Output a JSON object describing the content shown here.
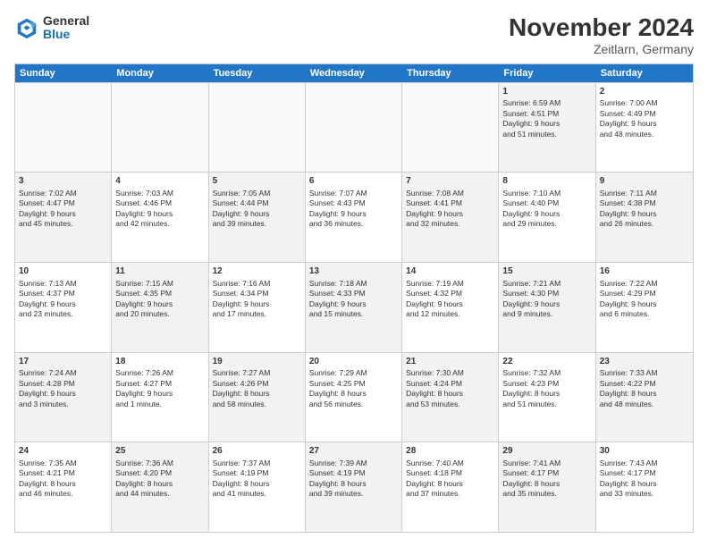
{
  "logo": {
    "general": "General",
    "blue": "Blue"
  },
  "title": "November 2024",
  "subtitle": "Zeitlarn, Germany",
  "header": {
    "days": [
      "Sunday",
      "Monday",
      "Tuesday",
      "Wednesday",
      "Thursday",
      "Friday",
      "Saturday"
    ]
  },
  "weeks": [
    {
      "cells": [
        {
          "day": "",
          "content": "",
          "empty": true
        },
        {
          "day": "",
          "content": "",
          "empty": true
        },
        {
          "day": "",
          "content": "",
          "empty": true
        },
        {
          "day": "",
          "content": "",
          "empty": true
        },
        {
          "day": "",
          "content": "",
          "empty": true
        },
        {
          "day": "1",
          "content": "Sunrise: 6:59 AM\nSunset: 4:51 PM\nDaylight: 9 hours\nand 51 minutes.",
          "shaded": true
        },
        {
          "day": "2",
          "content": "Sunrise: 7:00 AM\nSunset: 4:49 PM\nDaylight: 9 hours\nand 48 minutes.",
          "shaded": false
        }
      ]
    },
    {
      "cells": [
        {
          "day": "3",
          "content": "Sunrise: 7:02 AM\nSunset: 4:47 PM\nDaylight: 9 hours\nand 45 minutes.",
          "shaded": true
        },
        {
          "day": "4",
          "content": "Sunrise: 7:03 AM\nSunset: 4:46 PM\nDaylight: 9 hours\nand 42 minutes.",
          "shaded": false
        },
        {
          "day": "5",
          "content": "Sunrise: 7:05 AM\nSunset: 4:44 PM\nDaylight: 9 hours\nand 39 minutes.",
          "shaded": true
        },
        {
          "day": "6",
          "content": "Sunrise: 7:07 AM\nSunset: 4:43 PM\nDaylight: 9 hours\nand 36 minutes.",
          "shaded": false
        },
        {
          "day": "7",
          "content": "Sunrise: 7:08 AM\nSunset: 4:41 PM\nDaylight: 9 hours\nand 32 minutes.",
          "shaded": true
        },
        {
          "day": "8",
          "content": "Sunrise: 7:10 AM\nSunset: 4:40 PM\nDaylight: 9 hours\nand 29 minutes.",
          "shaded": false
        },
        {
          "day": "9",
          "content": "Sunrise: 7:11 AM\nSunset: 4:38 PM\nDaylight: 9 hours\nand 26 minutes.",
          "shaded": true
        }
      ]
    },
    {
      "cells": [
        {
          "day": "10",
          "content": "Sunrise: 7:13 AM\nSunset: 4:37 PM\nDaylight: 9 hours\nand 23 minutes.",
          "shaded": false
        },
        {
          "day": "11",
          "content": "Sunrise: 7:15 AM\nSunset: 4:35 PM\nDaylight: 9 hours\nand 20 minutes.",
          "shaded": true
        },
        {
          "day": "12",
          "content": "Sunrise: 7:16 AM\nSunset: 4:34 PM\nDaylight: 9 hours\nand 17 minutes.",
          "shaded": false
        },
        {
          "day": "13",
          "content": "Sunrise: 7:18 AM\nSunset: 4:33 PM\nDaylight: 9 hours\nand 15 minutes.",
          "shaded": true
        },
        {
          "day": "14",
          "content": "Sunrise: 7:19 AM\nSunset: 4:32 PM\nDaylight: 9 hours\nand 12 minutes.",
          "shaded": false
        },
        {
          "day": "15",
          "content": "Sunrise: 7:21 AM\nSunset: 4:30 PM\nDaylight: 9 hours\nand 9 minutes.",
          "shaded": true
        },
        {
          "day": "16",
          "content": "Sunrise: 7:22 AM\nSunset: 4:29 PM\nDaylight: 9 hours\nand 6 minutes.",
          "shaded": false
        }
      ]
    },
    {
      "cells": [
        {
          "day": "17",
          "content": "Sunrise: 7:24 AM\nSunset: 4:28 PM\nDaylight: 9 hours\nand 3 minutes.",
          "shaded": true
        },
        {
          "day": "18",
          "content": "Sunrise: 7:26 AM\nSunset: 4:27 PM\nDaylight: 9 hours\nand 1 minute.",
          "shaded": false
        },
        {
          "day": "19",
          "content": "Sunrise: 7:27 AM\nSunset: 4:26 PM\nDaylight: 8 hours\nand 58 minutes.",
          "shaded": true
        },
        {
          "day": "20",
          "content": "Sunrise: 7:29 AM\nSunset: 4:25 PM\nDaylight: 8 hours\nand 56 minutes.",
          "shaded": false
        },
        {
          "day": "21",
          "content": "Sunrise: 7:30 AM\nSunset: 4:24 PM\nDaylight: 8 hours\nand 53 minutes.",
          "shaded": true
        },
        {
          "day": "22",
          "content": "Sunrise: 7:32 AM\nSunset: 4:23 PM\nDaylight: 8 hours\nand 51 minutes.",
          "shaded": false
        },
        {
          "day": "23",
          "content": "Sunrise: 7:33 AM\nSunset: 4:22 PM\nDaylight: 8 hours\nand 48 minutes.",
          "shaded": true
        }
      ]
    },
    {
      "cells": [
        {
          "day": "24",
          "content": "Sunrise: 7:35 AM\nSunset: 4:21 PM\nDaylight: 8 hours\nand 46 minutes.",
          "shaded": false
        },
        {
          "day": "25",
          "content": "Sunrise: 7:36 AM\nSunset: 4:20 PM\nDaylight: 8 hours\nand 44 minutes.",
          "shaded": true
        },
        {
          "day": "26",
          "content": "Sunrise: 7:37 AM\nSunset: 4:19 PM\nDaylight: 8 hours\nand 41 minutes.",
          "shaded": false
        },
        {
          "day": "27",
          "content": "Sunrise: 7:39 AM\nSunset: 4:19 PM\nDaylight: 8 hours\nand 39 minutes.",
          "shaded": true
        },
        {
          "day": "28",
          "content": "Sunrise: 7:40 AM\nSunset: 4:18 PM\nDaylight: 8 hours\nand 37 minutes.",
          "shaded": false
        },
        {
          "day": "29",
          "content": "Sunrise: 7:41 AM\nSunset: 4:17 PM\nDaylight: 8 hours\nand 35 minutes.",
          "shaded": true
        },
        {
          "day": "30",
          "content": "Sunrise: 7:43 AM\nSunset: 4:17 PM\nDaylight: 8 hours\nand 33 minutes.",
          "shaded": false
        }
      ]
    }
  ]
}
